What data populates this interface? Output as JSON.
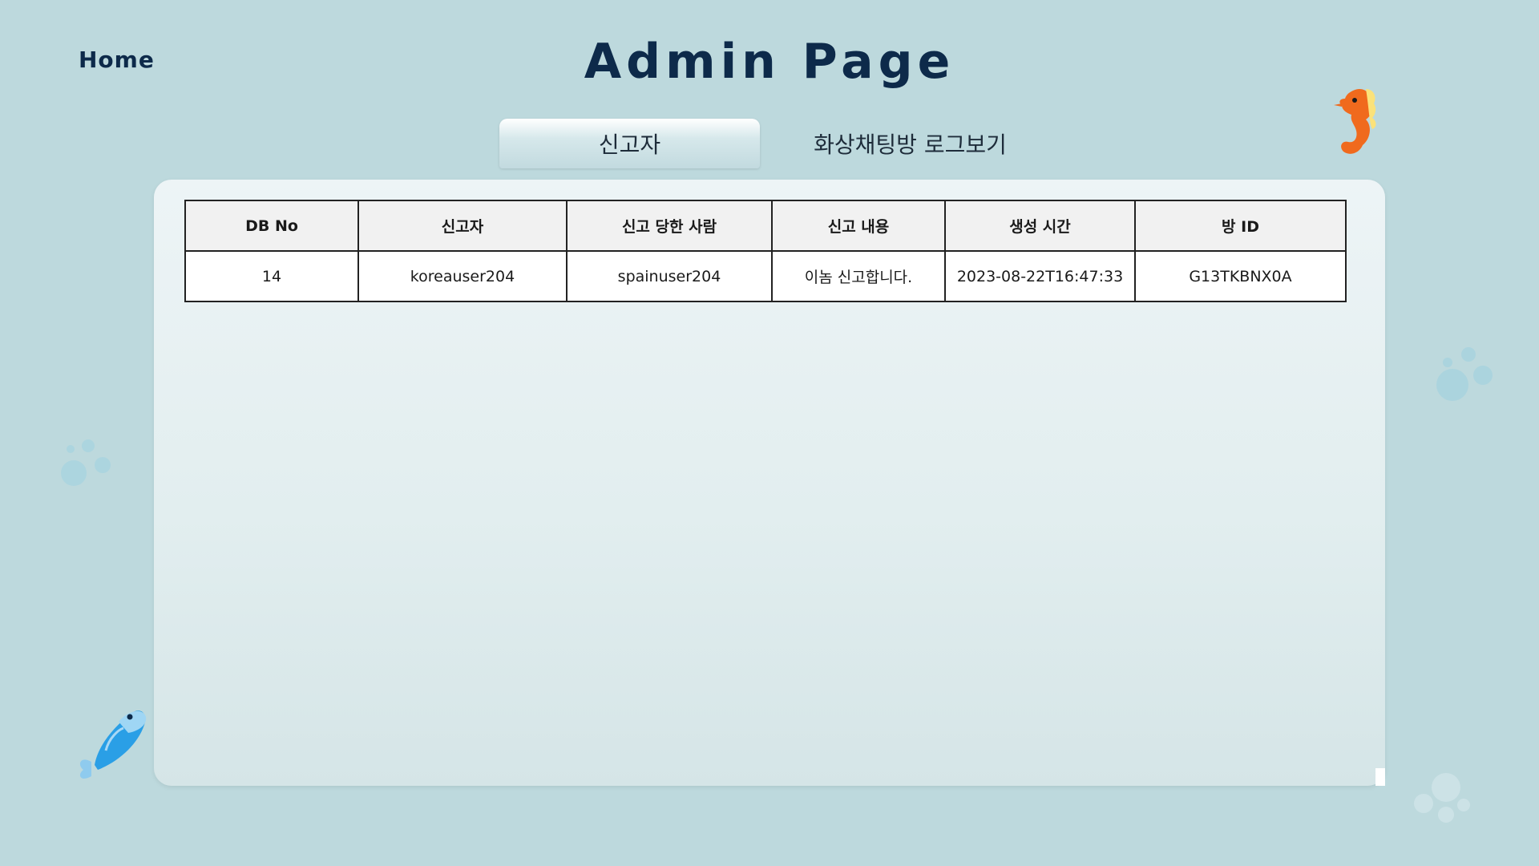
{
  "header": {
    "home_label": "Home",
    "title": "Admin Page"
  },
  "tabs": [
    {
      "label": "신고자",
      "active": true
    },
    {
      "label": "화상채팅방 로그보기",
      "active": false
    }
  ],
  "table": {
    "columns": [
      "DB No",
      "신고자",
      "신고 당한 사람",
      "신고 내용",
      "생성 시간",
      "방 ID"
    ],
    "rows": [
      {
        "db_no": "14",
        "reporter": "koreauser204",
        "reported": "spainuser204",
        "content": "이놈 신고합니다.",
        "created_at": "2023-08-22T16:47:33",
        "room_id": "G13TKBNX0A"
      }
    ]
  },
  "colors": {
    "background": "#bdd9dd",
    "title": "#0d2a4a",
    "panel": "#e6f0f2"
  },
  "icons": [
    "seahorse-icon",
    "fish-icon",
    "bubbles-icon"
  ]
}
